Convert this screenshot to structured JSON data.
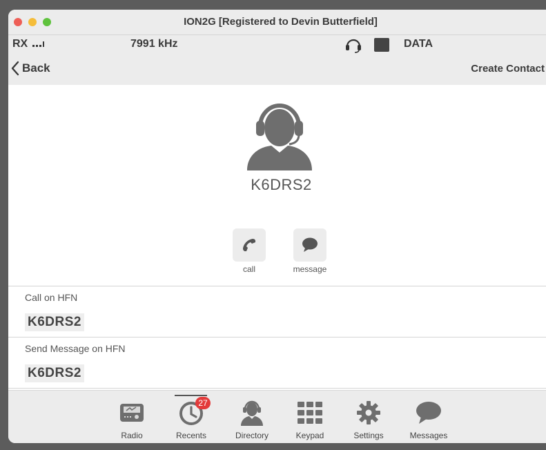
{
  "window": {
    "title": "ION2G [Registered to Devin Butterfield]"
  },
  "status": {
    "rx_label": "RX",
    "frequency": "7991 kHz",
    "mode": "DATA"
  },
  "nav": {
    "back_label": "Back",
    "create_contact_label": "Create Contact"
  },
  "contact": {
    "name": "K6DRS2",
    "actions": [
      {
        "label": "call",
        "icon": "phone-icon"
      },
      {
        "label": "message",
        "icon": "chat-bubble-icon"
      }
    ],
    "sections": [
      {
        "label": "Call on HFN",
        "value": "K6DRS2"
      },
      {
        "label": "Send Message on HFN",
        "value": "K6DRS2"
      }
    ]
  },
  "tabbar": {
    "tabs": [
      {
        "label": "Radio",
        "icon": "radio-icon"
      },
      {
        "label": "Recents",
        "icon": "clock-icon",
        "badge": "27",
        "active": true
      },
      {
        "label": "Directory",
        "icon": "person-headset-icon"
      },
      {
        "label": "Keypad",
        "icon": "keypad-icon"
      },
      {
        "label": "Settings",
        "icon": "gear-icon"
      },
      {
        "label": "Messages",
        "icon": "chat-bubble-icon"
      }
    ]
  },
  "colors": {
    "badge": "#e33b3b",
    "icon_gray": "#6e6e6e"
  }
}
